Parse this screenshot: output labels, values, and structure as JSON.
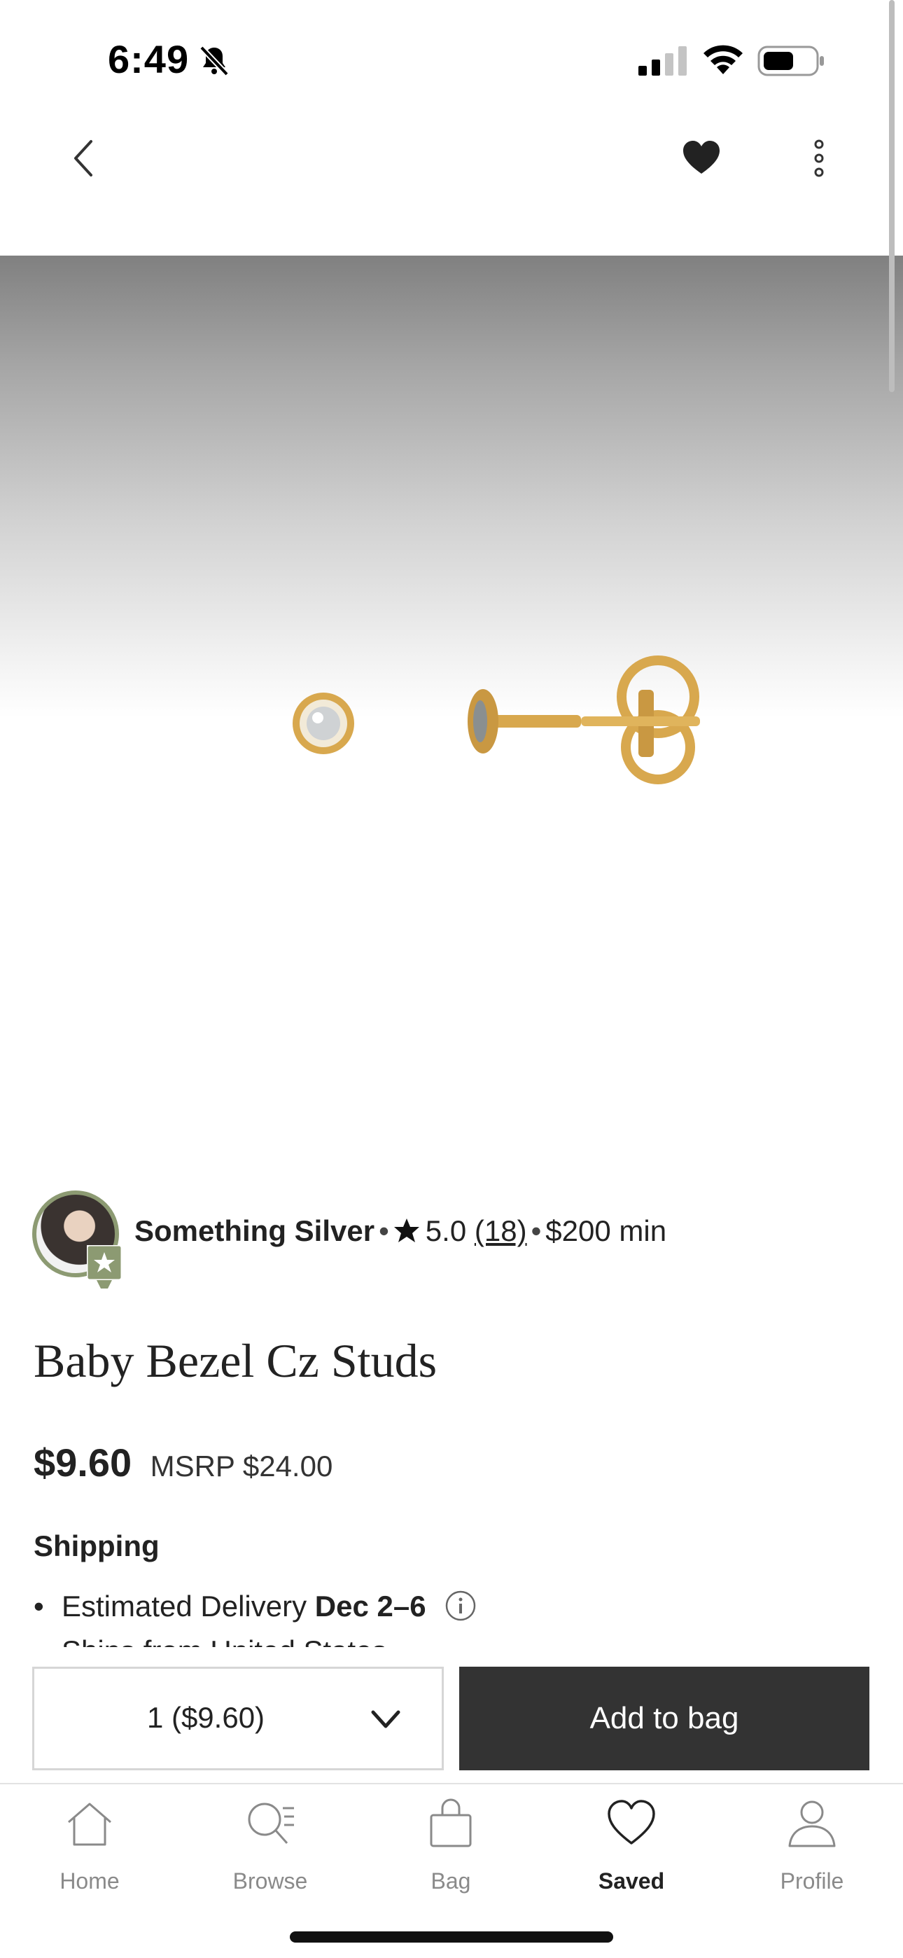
{
  "status_bar": {
    "time": "6:49"
  },
  "seller": {
    "name": "Something Silver",
    "separator": "•",
    "rating": "5.0",
    "review_count": "(18)",
    "minimum": "$200 min"
  },
  "product": {
    "title": "Baby Bezel Cz Studs",
    "price": "$9.60",
    "msrp": "MSRP $24.00"
  },
  "shipping": {
    "heading": "Shipping",
    "delivery_prefix": "Estimated Delivery ",
    "delivery_dates": "Dec 2–6",
    "ships_from": "Ships from United States"
  },
  "purchase": {
    "quantity": "1 ($9.60)",
    "add_to_bag": "Add to bag"
  },
  "tabs": [
    {
      "label": "Home",
      "icon": "home-icon"
    },
    {
      "label": "Browse",
      "icon": "browse-icon"
    },
    {
      "label": "Bag",
      "icon": "bag-icon"
    },
    {
      "label": "Saved",
      "icon": "heart-icon",
      "active": true
    },
    {
      "label": "Profile",
      "icon": "profile-icon"
    }
  ],
  "colors": {
    "primary_button": "#333333",
    "active_tab": "#222222",
    "inactive_tab": "#8a8a8a",
    "seller_badge": "#8c9a72",
    "gold": "#d4a24a"
  }
}
